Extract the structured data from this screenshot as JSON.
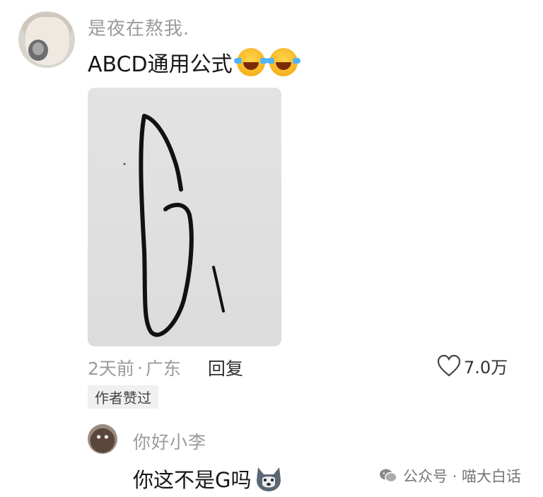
{
  "comment": {
    "username": "是夜在熬我.",
    "text": "ABCD通用公式",
    "emojis": [
      "laughing-crying-emoji",
      "laughing-crying-emoji"
    ],
    "time": "2天前",
    "separator": "·",
    "location": "广东",
    "reply_label": "回复",
    "likes": "7.0万",
    "author_badge": "作者赞过"
  },
  "reply": {
    "username": "你好小李",
    "text": "你这不是G吗",
    "emoji": "husky-dog-emoji"
  },
  "watermark": {
    "text": "公众号 · 喵大白话",
    "icon": "wechat-icon"
  },
  "colors": {
    "username": "#9a9a9a",
    "text": "#161616",
    "badge_bg": "#f0f0f0",
    "photo_bg": "#e0e0e0"
  }
}
